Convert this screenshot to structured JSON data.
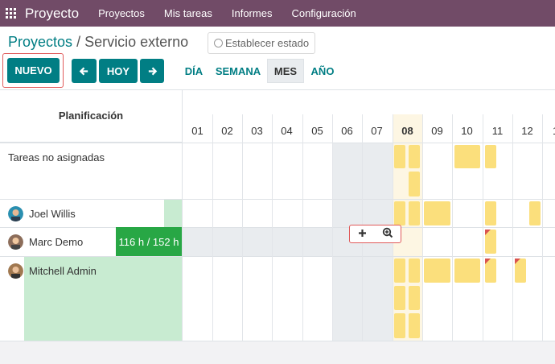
{
  "topbar": {
    "app_name": "Proyecto",
    "menu": [
      "Proyectos",
      "Mis tareas",
      "Informes",
      "Configuración"
    ]
  },
  "breadcrumb": {
    "parent": "Proyectos",
    "separator": "/",
    "current": "Servicio externo"
  },
  "status_button": "Establecer estado",
  "toolbar": {
    "new_label": "NUEVO",
    "today_label": "HOY",
    "prev_icon": "arrow-left-icon",
    "next_icon": "arrow-right-icon",
    "scales": [
      "DÍA",
      "SEMANA",
      "MES",
      "AÑO"
    ],
    "active_scale": "MES"
  },
  "grid": {
    "header_label": "Planificación",
    "days": [
      "01",
      "02",
      "03",
      "04",
      "05",
      "06",
      "07",
      "08",
      "09",
      "10",
      "11",
      "12",
      "1"
    ],
    "today": "08",
    "rows": [
      {
        "label": "Tareas no asignadas"
      },
      {
        "label": "Joel Willis"
      },
      {
        "label": "Marc Demo",
        "progress": "116 h / 152 h",
        "progress_ratio": 0.76
      },
      {
        "label": "Mitchell Admin"
      }
    ]
  },
  "colors": {
    "topbar": "#714b67",
    "accent": "#017e84",
    "task": "#fbdf7c",
    "progress": "#28a745",
    "highlight": "#e05a5a"
  }
}
